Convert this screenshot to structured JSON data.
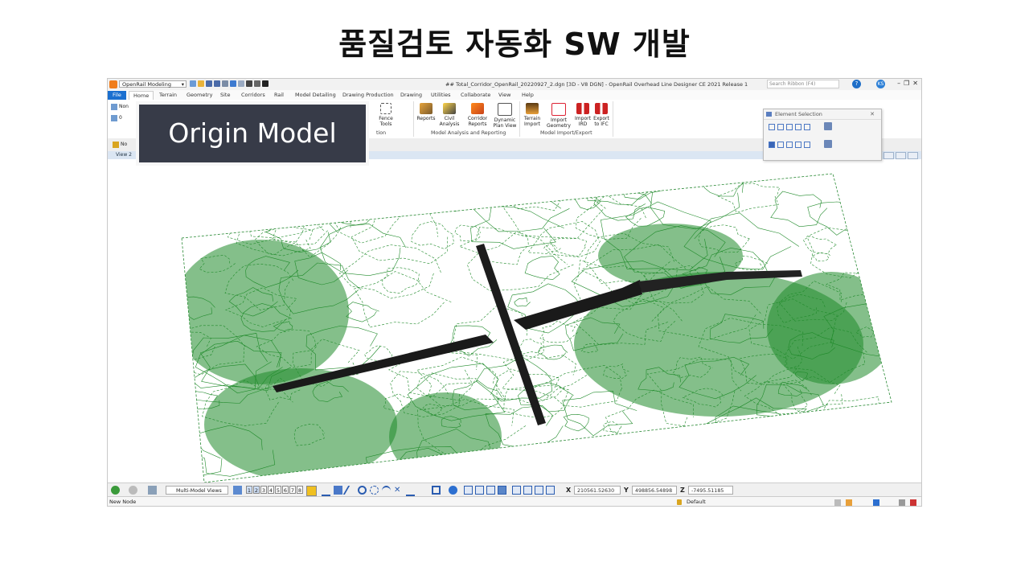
{
  "slide": {
    "title": "품질검토 자동화 SW 개발"
  },
  "overlay": {
    "label": "Origin Model"
  },
  "app": {
    "workspace": "OpenRail Modeling",
    "document_title": "## Total_Corridor_OpenRail_20220927_2.dgn [3D - V8 DGN] - OpenRail Overhead Line Designer CE 2021 Release 1",
    "search_placeholder": "Search Ribbon (F4)",
    "help_icon": "?",
    "user_badge": "KS"
  },
  "tabs": [
    "File",
    "Home",
    "Terrain",
    "Geometry",
    "Site",
    "Corridors",
    "Rail",
    "Model Detailing",
    "Drawing Production",
    "Drawing",
    "Utilities",
    "Collaborate",
    "View",
    "Help"
  ],
  "ribbon": {
    "left_fields": [
      "Non",
      "0",
      "No"
    ],
    "fence_tools": "Fence\nTools",
    "buttons": [
      {
        "label": "Reports",
        "icon": "reports-icon"
      },
      {
        "label": "Civil\nAnalysis",
        "icon": "civil-analysis-icon"
      },
      {
        "label": "Corridor\nReports",
        "icon": "corridor-reports-icon"
      },
      {
        "label": "Dynamic\nPlan View",
        "icon": "dynamic-plan-view-icon"
      },
      {
        "label": "Terrain\nImport",
        "icon": "terrain-import-icon"
      },
      {
        "label": "Import\nGeometry",
        "icon": "import-geometry-icon"
      },
      {
        "label": "Import\nIRD",
        "icon": "import-ird-icon"
      },
      {
        "label": "Export\nto IFC",
        "icon": "export-ifc-icon"
      }
    ],
    "groups": {
      "selection": "tion",
      "analysis": "Model Analysis and Reporting",
      "import_export": "Model Import/Export"
    }
  },
  "element_selection": {
    "title": "Element Selection"
  },
  "view": {
    "title": "View 2"
  },
  "status_tools": {
    "views_select": "Multi-Model Views",
    "view_numbers": [
      "1",
      "2",
      "3",
      "4",
      "5",
      "6",
      "7",
      "8"
    ],
    "x_label": "X",
    "x_value": "210561.52630",
    "y_label": "Y",
    "y_value": "498856.54898",
    "z_label": "Z",
    "z_value": "-7495.51185"
  },
  "statusbar": {
    "message": "New Node",
    "level": "Default"
  },
  "colors": {
    "terrain": "#1f8a2a",
    "corridor": "#1a1a1a",
    "accent": "#1a6fd0",
    "overlay_bg": "#373b48"
  }
}
